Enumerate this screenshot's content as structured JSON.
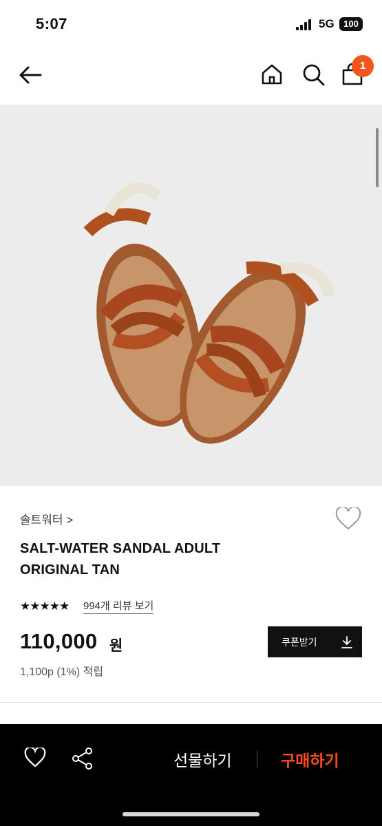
{
  "status": {
    "time": "5:07",
    "network": "5G",
    "battery": "100"
  },
  "nav": {
    "cart_count": "1"
  },
  "product": {
    "brand": "솔트워터",
    "brand_chevron": ">",
    "title_line1": "SALT-WATER SANDAL ADULT",
    "title_line2": "ORIGINAL TAN",
    "rating": 4.5,
    "rating_stars": "★★★★★",
    "reviews_link": "994개 리뷰 보기",
    "price": "110,000",
    "currency": "원",
    "points": "1,100p (1%) 적립",
    "coupon_label": "쿠폰받기"
  },
  "bottom_bar": {
    "gift_label": "선물하기",
    "buy_label": "구매하기"
  },
  "colors": {
    "accent": "#f2561d",
    "buy": "#ff4a1c",
    "bar": "#000000",
    "hero_bg": "#ececec"
  },
  "icons": [
    "back-arrow-icon",
    "home-icon",
    "search-icon",
    "cart-icon",
    "heart-icon",
    "share-icon",
    "download-icon"
  ]
}
